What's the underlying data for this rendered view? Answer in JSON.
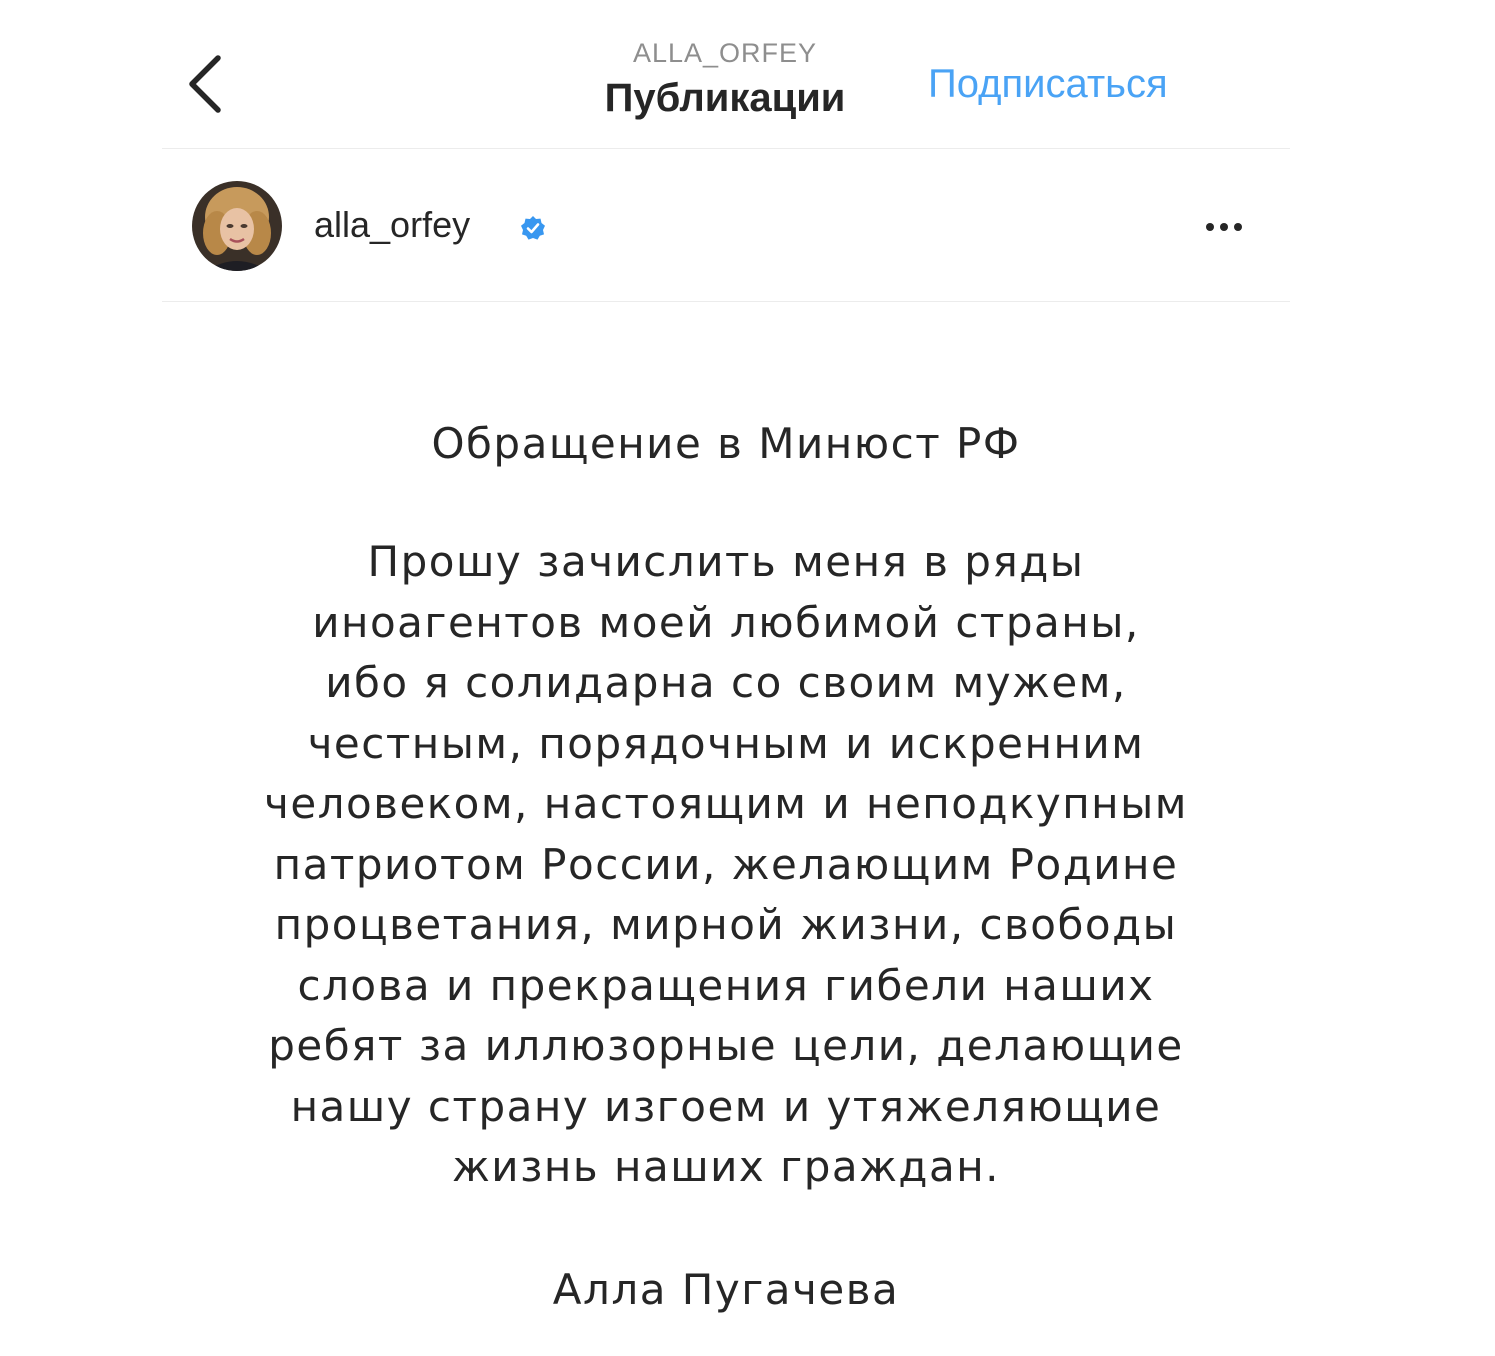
{
  "header": {
    "username": "ALLA_ORFEY",
    "title": "Публикации",
    "subscribe_label": "Подписаться",
    "back_icon": "chevron-left-icon"
  },
  "post": {
    "username": "alla_orfey",
    "verified_icon": "verified-badge-icon",
    "more_icon": "more-options-icon",
    "heading": "Обращение в Минюст РФ",
    "lines": [
      "Прошу зачислить меня в ряды",
      "иноагентов моей любимой страны,",
      "ибо я солидарна со своим мужем,",
      "честным, порядочным и искренним",
      "человеком, настоящим и неподкупным",
      "патриотом России, желающим Родине",
      "процветания, мирной жизни, свободы",
      "слова и прекращения гибели наших",
      "ребят за иллюзорные цели, делающие",
      "нашу страну изгоем и утяжеляющие",
      "жизнь наших граждан."
    ],
    "signature": "Алла Пугачева"
  },
  "colors": {
    "accent": "#4aa3f5",
    "verified": "#3897f0",
    "text": "#262626",
    "secondary_text": "#8e8e8e",
    "divider": "#ececec"
  }
}
